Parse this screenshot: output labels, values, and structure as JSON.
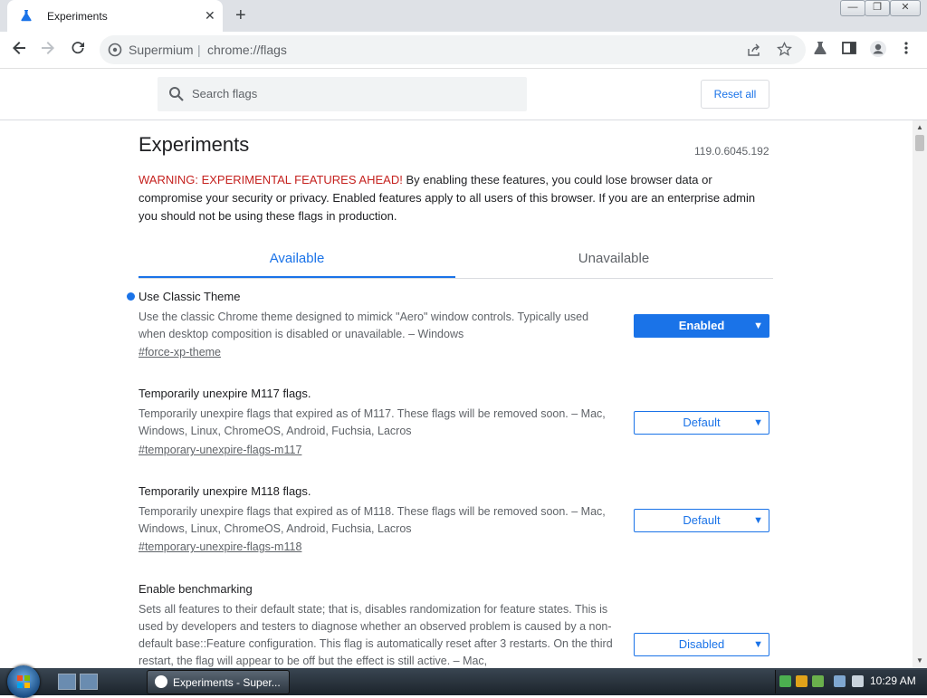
{
  "tab": {
    "title": "Experiments"
  },
  "toolbar": {
    "site_name": "Supermium",
    "separator": "|",
    "url": "chrome://flags"
  },
  "flags_header": {
    "search_placeholder": "Search flags",
    "reset_label": "Reset all"
  },
  "page": {
    "title": "Experiments",
    "version": "119.0.6045.192",
    "warning_label": "WARNING: EXPERIMENTAL FEATURES AHEAD!",
    "warning_text": " By enabling these features, you could lose browser data or compromise your security or privacy. Enabled features apply to all users of this browser. If you are an enterprise admin you should not be using these flags in production.",
    "tabs": [
      "Available",
      "Unavailable"
    ]
  },
  "flags": [
    {
      "name": "Use Classic Theme",
      "description": "Use the classic Chrome theme designed to mimick \"Aero\" window controls. Typically used when desktop composition is disabled or unavailable. – Windows",
      "link": "#force-xp-theme",
      "state": "Enabled"
    },
    {
      "name": "Temporarily unexpire M117 flags.",
      "description": "Temporarily unexpire flags that expired as of M117. These flags will be removed soon. – Mac, Windows, Linux, ChromeOS, Android, Fuchsia, Lacros",
      "link": "#temporary-unexpire-flags-m117",
      "state": "Default"
    },
    {
      "name": "Temporarily unexpire M118 flags.",
      "description": "Temporarily unexpire flags that expired as of M118. These flags will be removed soon. – Mac, Windows, Linux, ChromeOS, Android, Fuchsia, Lacros",
      "link": "#temporary-unexpire-flags-m118",
      "state": "Default"
    },
    {
      "name": "Enable benchmarking",
      "description": "Sets all features to their default state; that is, disables randomization for feature states. This is used by developers and testers to diagnose whether an observed problem is caused by a non-default base::Feature configuration. This flag is automatically reset after 3 restarts. On the third restart, the flag will appear to be off but the effect is still active. – Mac,",
      "link": "",
      "state": "Disabled"
    }
  ],
  "taskbar": {
    "task_label": "Experiments - Super...",
    "clock": "10:29 AM"
  },
  "colors": {
    "accent": "#1a73e8",
    "warning": "#c5221f"
  }
}
